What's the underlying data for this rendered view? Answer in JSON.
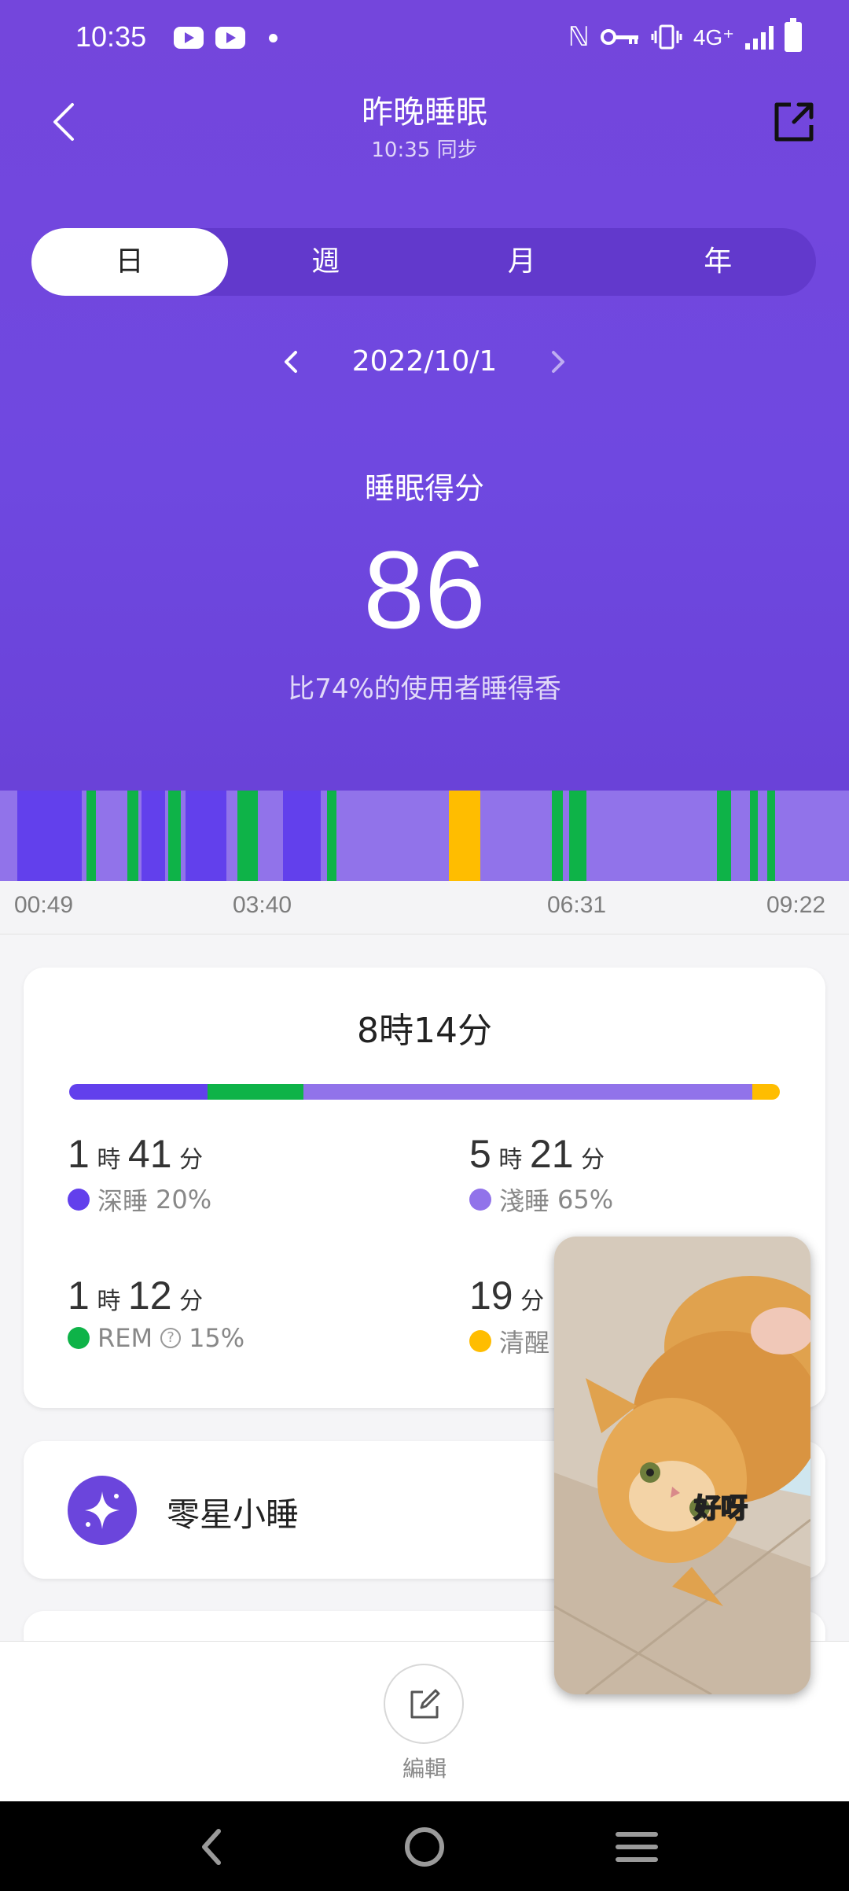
{
  "status_bar": {
    "time": "10:35",
    "network": "4G⁺"
  },
  "header": {
    "title": "昨晚睡眠",
    "sync_text": "10:35 同步"
  },
  "tabs": [
    {
      "label": "日",
      "active": true
    },
    {
      "label": "週",
      "active": false
    },
    {
      "label": "月",
      "active": false
    },
    {
      "label": "年",
      "active": false
    }
  ],
  "date": "2022/10/1",
  "score": {
    "label": "睡眠得分",
    "value": "86",
    "comparison": "比74%的使用者睡得香"
  },
  "timeline": {
    "ticks": [
      "00:49",
      "03:40",
      "06:31",
      "09:22"
    ],
    "colors": {
      "deep": "#6240ec",
      "light": "#9173ea",
      "rem": "#0eb348",
      "awake": "#ffbd00"
    }
  },
  "summary": {
    "total": "8時14分",
    "stages": [
      {
        "id": "deep",
        "hours": "1",
        "minutes": "41",
        "label": "深睡",
        "percent": "20%",
        "color": "#6240ec",
        "share": 20
      },
      {
        "id": "light",
        "hours": "5",
        "minutes": "21",
        "label": "淺睡",
        "percent": "65%",
        "color": "#9173ea",
        "share": 65
      },
      {
        "id": "rem",
        "hours": "1",
        "minutes": "12",
        "label": "REM",
        "percent": "15%",
        "color": "#0eb348",
        "share": 14
      },
      {
        "id": "awake",
        "hours": "",
        "minutes": "19",
        "label": "清醒",
        "percent": "",
        "color": "#ffbd00",
        "share": 4
      }
    ],
    "unit_hour": "時",
    "unit_minute": "分"
  },
  "nap": {
    "label": "零星小睡"
  },
  "edit": {
    "label": "編輯"
  },
  "pip_video": {
    "caption": "好呀"
  }
}
